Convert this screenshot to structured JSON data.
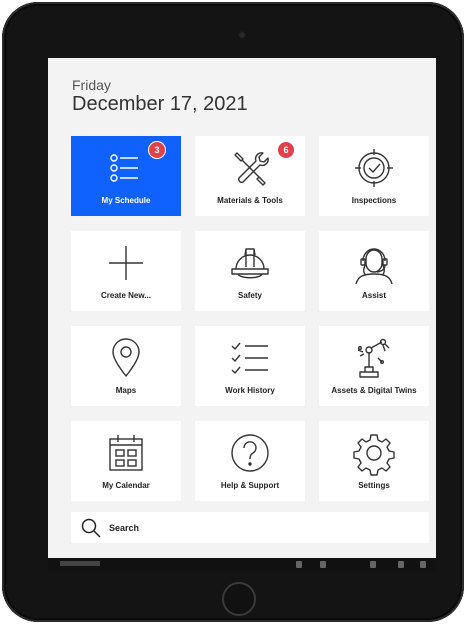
{
  "header": {
    "day": "Friday",
    "date": "December 17, 2021"
  },
  "tiles": [
    {
      "label": "My Schedule",
      "icon": "list-icon",
      "badge": "3",
      "active": true
    },
    {
      "label": "Materials & Tools",
      "icon": "tools-icon",
      "badge": "6",
      "active": false
    },
    {
      "label": "Inspections",
      "icon": "inspection-target-icon",
      "active": false
    },
    {
      "label": "Create New...",
      "icon": "plus-icon",
      "active": false
    },
    {
      "label": "Safety",
      "icon": "hard-hat-icon",
      "active": false
    },
    {
      "label": "Assist",
      "icon": "headset-agent-icon",
      "active": false
    },
    {
      "label": "Maps",
      "icon": "map-pin-icon",
      "active": false
    },
    {
      "label": "Work History",
      "icon": "checklist-icon",
      "active": false
    },
    {
      "label": "Assets & Digital Twins",
      "icon": "robot-arm-icon",
      "active": false
    },
    {
      "label": "My Calendar",
      "icon": "calendar-icon",
      "active": false
    },
    {
      "label": "Help & Support",
      "icon": "question-icon",
      "active": false
    },
    {
      "label": "Settings",
      "icon": "gear-icon",
      "active": false
    }
  ],
  "search": {
    "label": "Search",
    "icon": "search-icon"
  },
  "colors": {
    "accent": "#0f62fe",
    "badge": "#e0414b",
    "tile_bg": "#ffffff",
    "screen_bg": "#f3f3f3"
  }
}
